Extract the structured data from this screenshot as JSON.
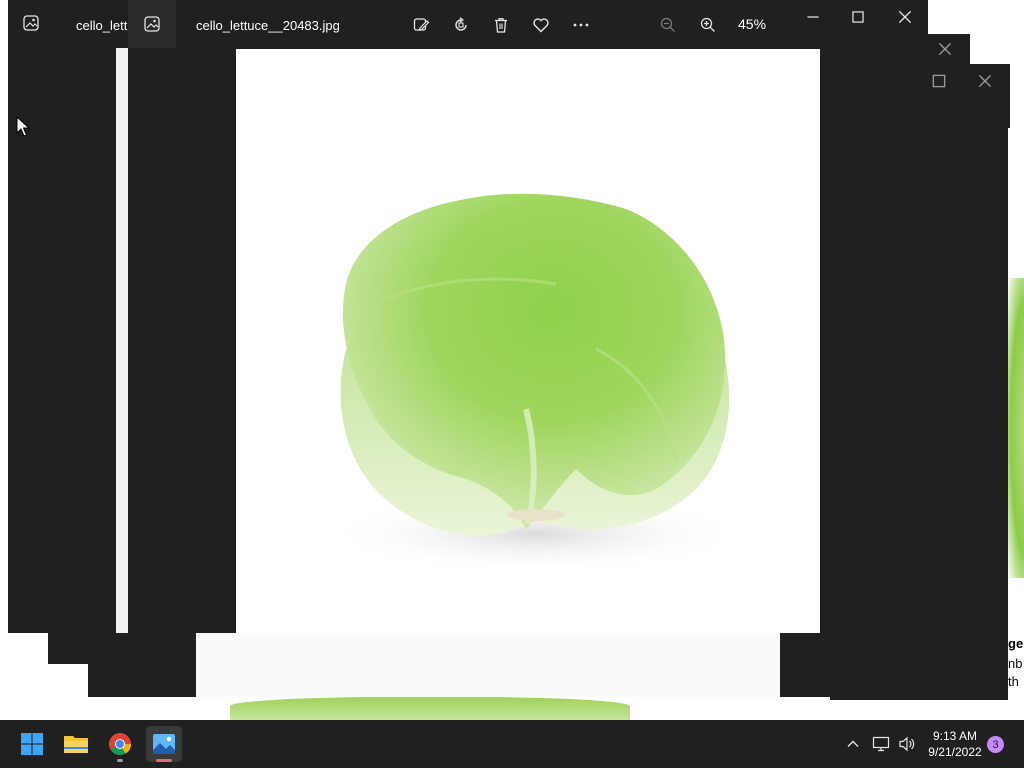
{
  "background_windows": {
    "right_peek_texts": [
      "ge",
      "nb",
      "th"
    ]
  },
  "back_window": {
    "title": "cello_lettu"
  },
  "front_window": {
    "title": "cello_lettuce__20483.jpg",
    "zoom": "45%",
    "toolbar": {
      "edit_icon": "edit-image-icon",
      "rotate_icon": "rotate-icon",
      "delete_icon": "delete-icon",
      "favorite_icon": "heart-icon",
      "more_icon": "more-icon",
      "zoom_out_icon": "zoom-out-icon",
      "zoom_in_icon": "zoom-in-icon"
    }
  },
  "image": {
    "subject": "iceberg lettuce",
    "colors": {
      "leaf_dark": "#6fbf2a",
      "leaf_light": "#b8dc7e",
      "leaf_pale": "#dcefbf",
      "stem": "#e7e3c8"
    }
  },
  "taskbar": {
    "apps": [
      "start",
      "file-explorer",
      "chrome",
      "photos"
    ],
    "time": "9:13 AM",
    "date": "9/21/2022",
    "notification_count": "3"
  },
  "colors": {
    "window_bg": "#202020",
    "taskbar_bg": "#202020",
    "accent": "#e06c75",
    "badge": "#c58af9"
  }
}
